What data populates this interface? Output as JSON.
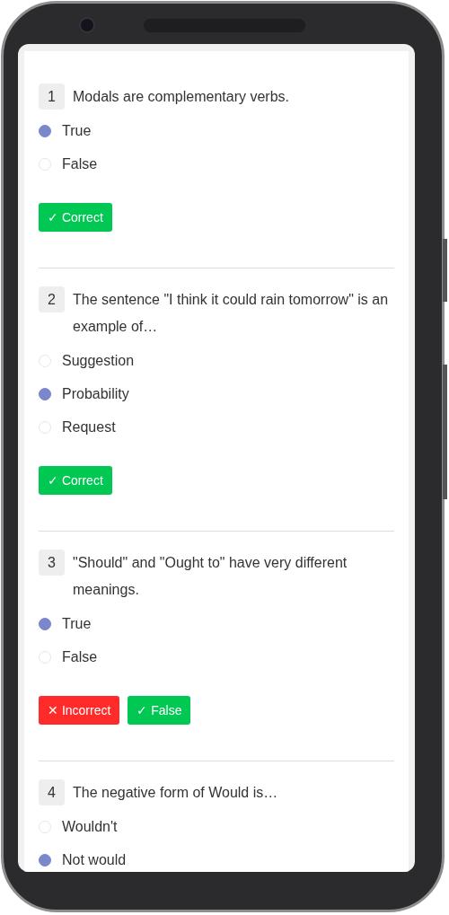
{
  "questions": [
    {
      "number": "1",
      "text": "Modals are complementary verbs.",
      "options": [
        {
          "label": "True",
          "selected": true
        },
        {
          "label": "False",
          "selected": false
        }
      ],
      "results": [
        {
          "kind": "correct",
          "text": "✓ Correct"
        }
      ]
    },
    {
      "number": "2",
      "text": "The sentence \"I think it could rain tomorrow\" is an example of…",
      "options": [
        {
          "label": "Suggestion",
          "selected": false
        },
        {
          "label": "Probability",
          "selected": true
        },
        {
          "label": "Request",
          "selected": false
        }
      ],
      "results": [
        {
          "kind": "correct",
          "text": "✓ Correct"
        }
      ]
    },
    {
      "number": "3",
      "text": "\"Should\" and \"Ought to\" have very different meanings.",
      "options": [
        {
          "label": "True",
          "selected": true
        },
        {
          "label": "False",
          "selected": false
        }
      ],
      "results": [
        {
          "kind": "incorrect",
          "text": "✕ Incorrect"
        },
        {
          "kind": "correct",
          "text": "✓ False"
        }
      ]
    },
    {
      "number": "4",
      "text": "The negative form of Would is…",
      "options": [
        {
          "label": "Wouldn't",
          "selected": false
        },
        {
          "label": "Not would",
          "selected": true
        }
      ]
    }
  ]
}
